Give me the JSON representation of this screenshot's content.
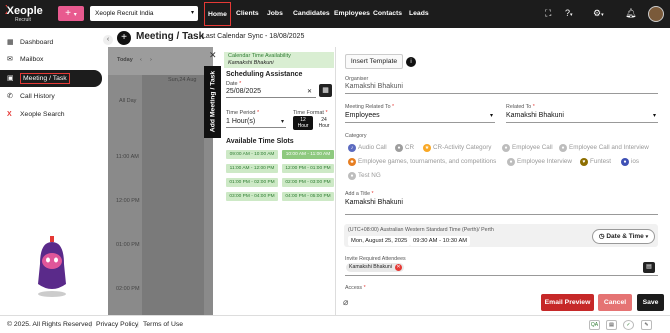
{
  "topbar": {
    "logo_text": "Xeople",
    "logo_sub": "Recruit",
    "add_label": "+",
    "add_chevron": "▾",
    "org_select": "Xeople Recruit India",
    "nav": [
      "Home",
      "Clients",
      "Jobs",
      "Candidates",
      "Employees",
      "Contacts",
      "Leads"
    ],
    "icons": [
      "expand-icon",
      "help-icon",
      "settings-icon",
      "bell-icon",
      "user-avatar"
    ]
  },
  "sidebar": {
    "items": [
      {
        "label": "Dashboard",
        "icon": "dashboard-icon"
      },
      {
        "label": "Mailbox",
        "icon": "mail-icon"
      },
      {
        "label": "Meeting / Task",
        "icon": "calendar-icon"
      },
      {
        "label": "Call History",
        "icon": "phone-icon"
      },
      {
        "label": "Xeople Search",
        "icon": "x-search-icon"
      }
    ],
    "collapse_glyph": "‹"
  },
  "header": {
    "title": "Meeting / Task",
    "sync": "Last Calendar Sync - 18/08/2025"
  },
  "calendar": {
    "view_label": "Today",
    "day_label": "Sun,24 Aug",
    "all_day": "All Day",
    "times": [
      "11:00 AM",
      "12:00 PM",
      "01:00 PM",
      "02:00 PM"
    ]
  },
  "drawer_tab": "Add Meeting / Task",
  "schedule": {
    "availability_title": "Calendar Time Availability",
    "availability_user": "Kamakshi Bhakuni",
    "heading": "Scheduling Assistance",
    "date_label": "Date",
    "date_value": "25/08/2025",
    "time_period_label": "Time Period",
    "time_period_value": "1 Hour(s)",
    "time_format_label": "Time Format",
    "tf12_a": "12",
    "tf12_b": "Hour",
    "tf24_a": "24",
    "tf24_b": "Hour",
    "slots_heading": "Available Time Slots",
    "slots": [
      "09:00 AM - 10:00 AM",
      "10:00 AM - 11:00 AM",
      "11:00 AM - 12:00 PM",
      "12:00 PM - 01:00 PM",
      "01:00 PM - 02:00 PM",
      "02:00 PM - 03:00 PM",
      "03:00 PM - 04:00 PM",
      "04:00 PM - 05:00 PM"
    ]
  },
  "form": {
    "insert_template": "Insert Template",
    "organiser_label": "Organiser",
    "organiser_value": "Kamakshi Bhakuni",
    "related_to_label": "Meeting Related To",
    "related_to_value": "Employees",
    "related_label": "Related To",
    "related_value": "Kamakshi Bhakuni",
    "category_label": "Category",
    "categories": [
      {
        "label": "Audio Call",
        "color": "#5c6bc0"
      },
      {
        "label": "CR",
        "color": "#9e9e9e"
      },
      {
        "label": "CR-Activity Category",
        "color": "#f9a825"
      },
      {
        "label": "Employee Call",
        "color": "#bdbdbd"
      },
      {
        "label": "Employee Call and Interview",
        "color": "#bdbdbd"
      },
      {
        "label": "Employee games, tournaments, and competitions",
        "color": "#e67e22"
      },
      {
        "label": "Employee Interview",
        "color": "#bdbdbd"
      },
      {
        "label": "Funtest",
        "color": "#8d6e00"
      },
      {
        "label": "ios",
        "color": "#3f51b5"
      },
      {
        "label": "Test NG",
        "color": "#bdbdbd"
      }
    ],
    "title_label": "Add a Title",
    "title_value": "Kamakshi Bhakuni",
    "timezone": "(UTC+08:00) Australian Western Standard Time (Perth)/ Perth",
    "date_chip": "Mon, August 25, 2025",
    "time_chip": "09:30 AM - 10:30 AM",
    "date_time_button": "Date & Time",
    "attendees_label": "Invite Required Attendees",
    "attendee": "Kamakshi Bhakuni",
    "access_label": "Access"
  },
  "actions": {
    "email_preview": "Email Preview",
    "cancel": "Cancel",
    "save": "Save"
  },
  "footer": {
    "copyright": "© 2025. All Rights Reserved",
    "privacy": "Privacy Policy",
    "terms": "Terms of Use",
    "qa": "QA"
  },
  "colors": {
    "brand_red": "#e53935",
    "dark": "#1c1c1c",
    "slot_green": "#cde9c6"
  }
}
